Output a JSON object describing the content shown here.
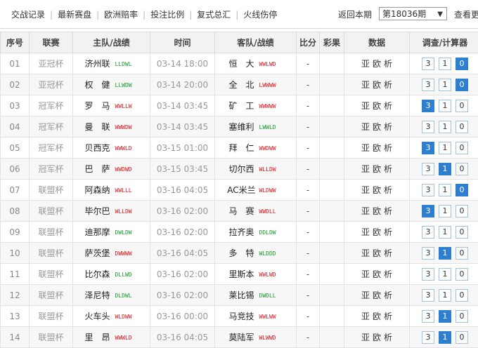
{
  "nav": {
    "links": [
      "交战记录",
      "最新赛盘",
      "欧洲赔率",
      "投注比例",
      "复式总汇",
      "火线伤停"
    ],
    "period_label": "返回本期",
    "period_value": "第18036期",
    "more_label": "查看更"
  },
  "table": {
    "headers": [
      "序号",
      "联赛",
      "主队/战绩",
      "时间",
      "客队/战绩",
      "比分",
      "彩果",
      "数据",
      "调查/计算器"
    ],
    "rows": [
      {
        "no": "01",
        "league": "亚冠杯",
        "home": "济州联",
        "home_form": "LLDWL",
        "home_color": "g",
        "time": "03-14 18:00",
        "away": "恒　大",
        "away_form": "WWLWD",
        "away_color": "r",
        "score": "-",
        "result": "",
        "links": [
          "亚",
          "欧",
          "析"
        ],
        "calc": [
          "3",
          "1",
          "0"
        ],
        "active": 2
      },
      {
        "no": "02",
        "league": "亚冠杯",
        "home": "权　健",
        "home_form": "LLWDW",
        "home_color": "g",
        "time": "03-14 20:00",
        "away": "全　北",
        "away_form": "LWWWW",
        "away_color": "r",
        "score": "-",
        "result": "",
        "links": [
          "亚",
          "欧",
          "析"
        ],
        "calc": [
          "3",
          "1",
          "0"
        ],
        "active": 2
      },
      {
        "no": "03",
        "league": "冠军杯",
        "home": "罗　马",
        "home_form": "WWLLW",
        "home_color": "r",
        "time": "03-14 03:45",
        "away": "矿　工",
        "away_form": "WWWWW",
        "away_color": "r",
        "score": "-",
        "result": "",
        "links": [
          "亚",
          "欧",
          "析"
        ],
        "calc": [
          "3",
          "1",
          "0"
        ],
        "active": 0
      },
      {
        "no": "04",
        "league": "冠军杯",
        "home": "曼　联",
        "home_form": "WWWDW",
        "home_color": "r",
        "time": "03-14 03:45",
        "away": "塞维利",
        "away_form": "LWWLD",
        "away_color": "g",
        "score": "-",
        "result": "",
        "links": [
          "亚",
          "欧",
          "析"
        ],
        "calc": [
          "3",
          "1",
          "0"
        ],
        "active": -1
      },
      {
        "no": "05",
        "league": "冠军杯",
        "home": "贝西克",
        "home_form": "WWWLD",
        "home_color": "r",
        "time": "03-15 01:00",
        "away": "拜　仁",
        "away_form": "WWDWW",
        "away_color": "r",
        "score": "-",
        "result": "",
        "links": [
          "亚",
          "欧",
          "析"
        ],
        "calc": [
          "3",
          "1",
          "0"
        ],
        "active": 0
      },
      {
        "no": "06",
        "league": "冠军杯",
        "home": "巴　萨",
        "home_form": "WWDWD",
        "home_color": "r",
        "time": "03-15 03:45",
        "away": "切尔西",
        "away_form": "WLLDW",
        "away_color": "r",
        "score": "-",
        "result": "",
        "links": [
          "亚",
          "欧",
          "析"
        ],
        "calc": [
          "3",
          "1",
          "0"
        ],
        "active": 1
      },
      {
        "no": "07",
        "league": "联盟杯",
        "home": "阿森纳",
        "home_form": "WWLLL",
        "home_color": "r",
        "time": "03-16 04:05",
        "away": "AC米兰",
        "away_form": "WLDWW",
        "away_color": "r",
        "score": "-",
        "result": "",
        "links": [
          "亚",
          "欧",
          "析"
        ],
        "calc": [
          "3",
          "1",
          "0"
        ],
        "active": 2
      },
      {
        "no": "08",
        "league": "联盟杯",
        "home": "毕尔巴",
        "home_form": "WLLDW",
        "home_color": "r",
        "time": "03-16 02:00",
        "away": "马　赛",
        "away_form": "WWDLL",
        "away_color": "r",
        "score": "-",
        "result": "",
        "links": [
          "亚",
          "欧",
          "析"
        ],
        "calc": [
          "3",
          "1",
          "0"
        ],
        "active": 0
      },
      {
        "no": "09",
        "league": "联盟杯",
        "home": "迪那摩",
        "home_form": "DWLDW",
        "home_color": "g",
        "time": "03-16 02:00",
        "away": "拉齐奥",
        "away_form": "DDLDW",
        "away_color": "g",
        "score": "-",
        "result": "",
        "links": [
          "亚",
          "欧",
          "析"
        ],
        "calc": [
          "3",
          "1",
          "0"
        ],
        "active": -1
      },
      {
        "no": "10",
        "league": "联盟杯",
        "home": "萨茨堡",
        "home_form": "DWWWW",
        "home_color": "r",
        "time": "03-16 04:05",
        "away": "多　特",
        "away_form": "WLDDD",
        "away_color": "g",
        "score": "-",
        "result": "",
        "links": [
          "亚",
          "欧",
          "析"
        ],
        "calc": [
          "3",
          "1",
          "0"
        ],
        "active": 1
      },
      {
        "no": "11",
        "league": "联盟杯",
        "home": "比尔森",
        "home_form": "DLLWD",
        "home_color": "g",
        "time": "03-16 02:00",
        "away": "里斯本",
        "away_form": "WWLWD",
        "away_color": "r",
        "score": "-",
        "result": "",
        "links": [
          "亚",
          "欧",
          "析"
        ],
        "calc": [
          "3",
          "1",
          "0"
        ],
        "active": -1
      },
      {
        "no": "12",
        "league": "联盟杯",
        "home": "泽尼特",
        "home_form": "DLDWL",
        "home_color": "g",
        "time": "03-16 02:00",
        "away": "莱比锡",
        "away_form": "DWDLL",
        "away_color": "g",
        "score": "-",
        "result": "",
        "links": [
          "亚",
          "欧",
          "析"
        ],
        "calc": [
          "3",
          "1",
          "0"
        ],
        "active": -1
      },
      {
        "no": "13",
        "league": "联盟杯",
        "home": "火车头",
        "home_form": "WLDWW",
        "home_color": "r",
        "time": "03-16 00:00",
        "away": "马竞技",
        "away_form": "WWLWW",
        "away_color": "r",
        "score": "-",
        "result": "",
        "links": [
          "亚",
          "欧",
          "析"
        ],
        "calc": [
          "3",
          "1",
          "0"
        ],
        "active": 1
      },
      {
        "no": "14",
        "league": "联盟杯",
        "home": "里　昂",
        "home_form": "WWWLD",
        "home_color": "r",
        "time": "03-16 04:05",
        "away": "莫陆军",
        "away_form": "WLWWD",
        "away_color": "r",
        "score": "-",
        "result": "",
        "links": [
          "亚",
          "欧",
          "析"
        ],
        "calc": [
          "3",
          "1",
          "0"
        ],
        "active": 1
      }
    ]
  }
}
